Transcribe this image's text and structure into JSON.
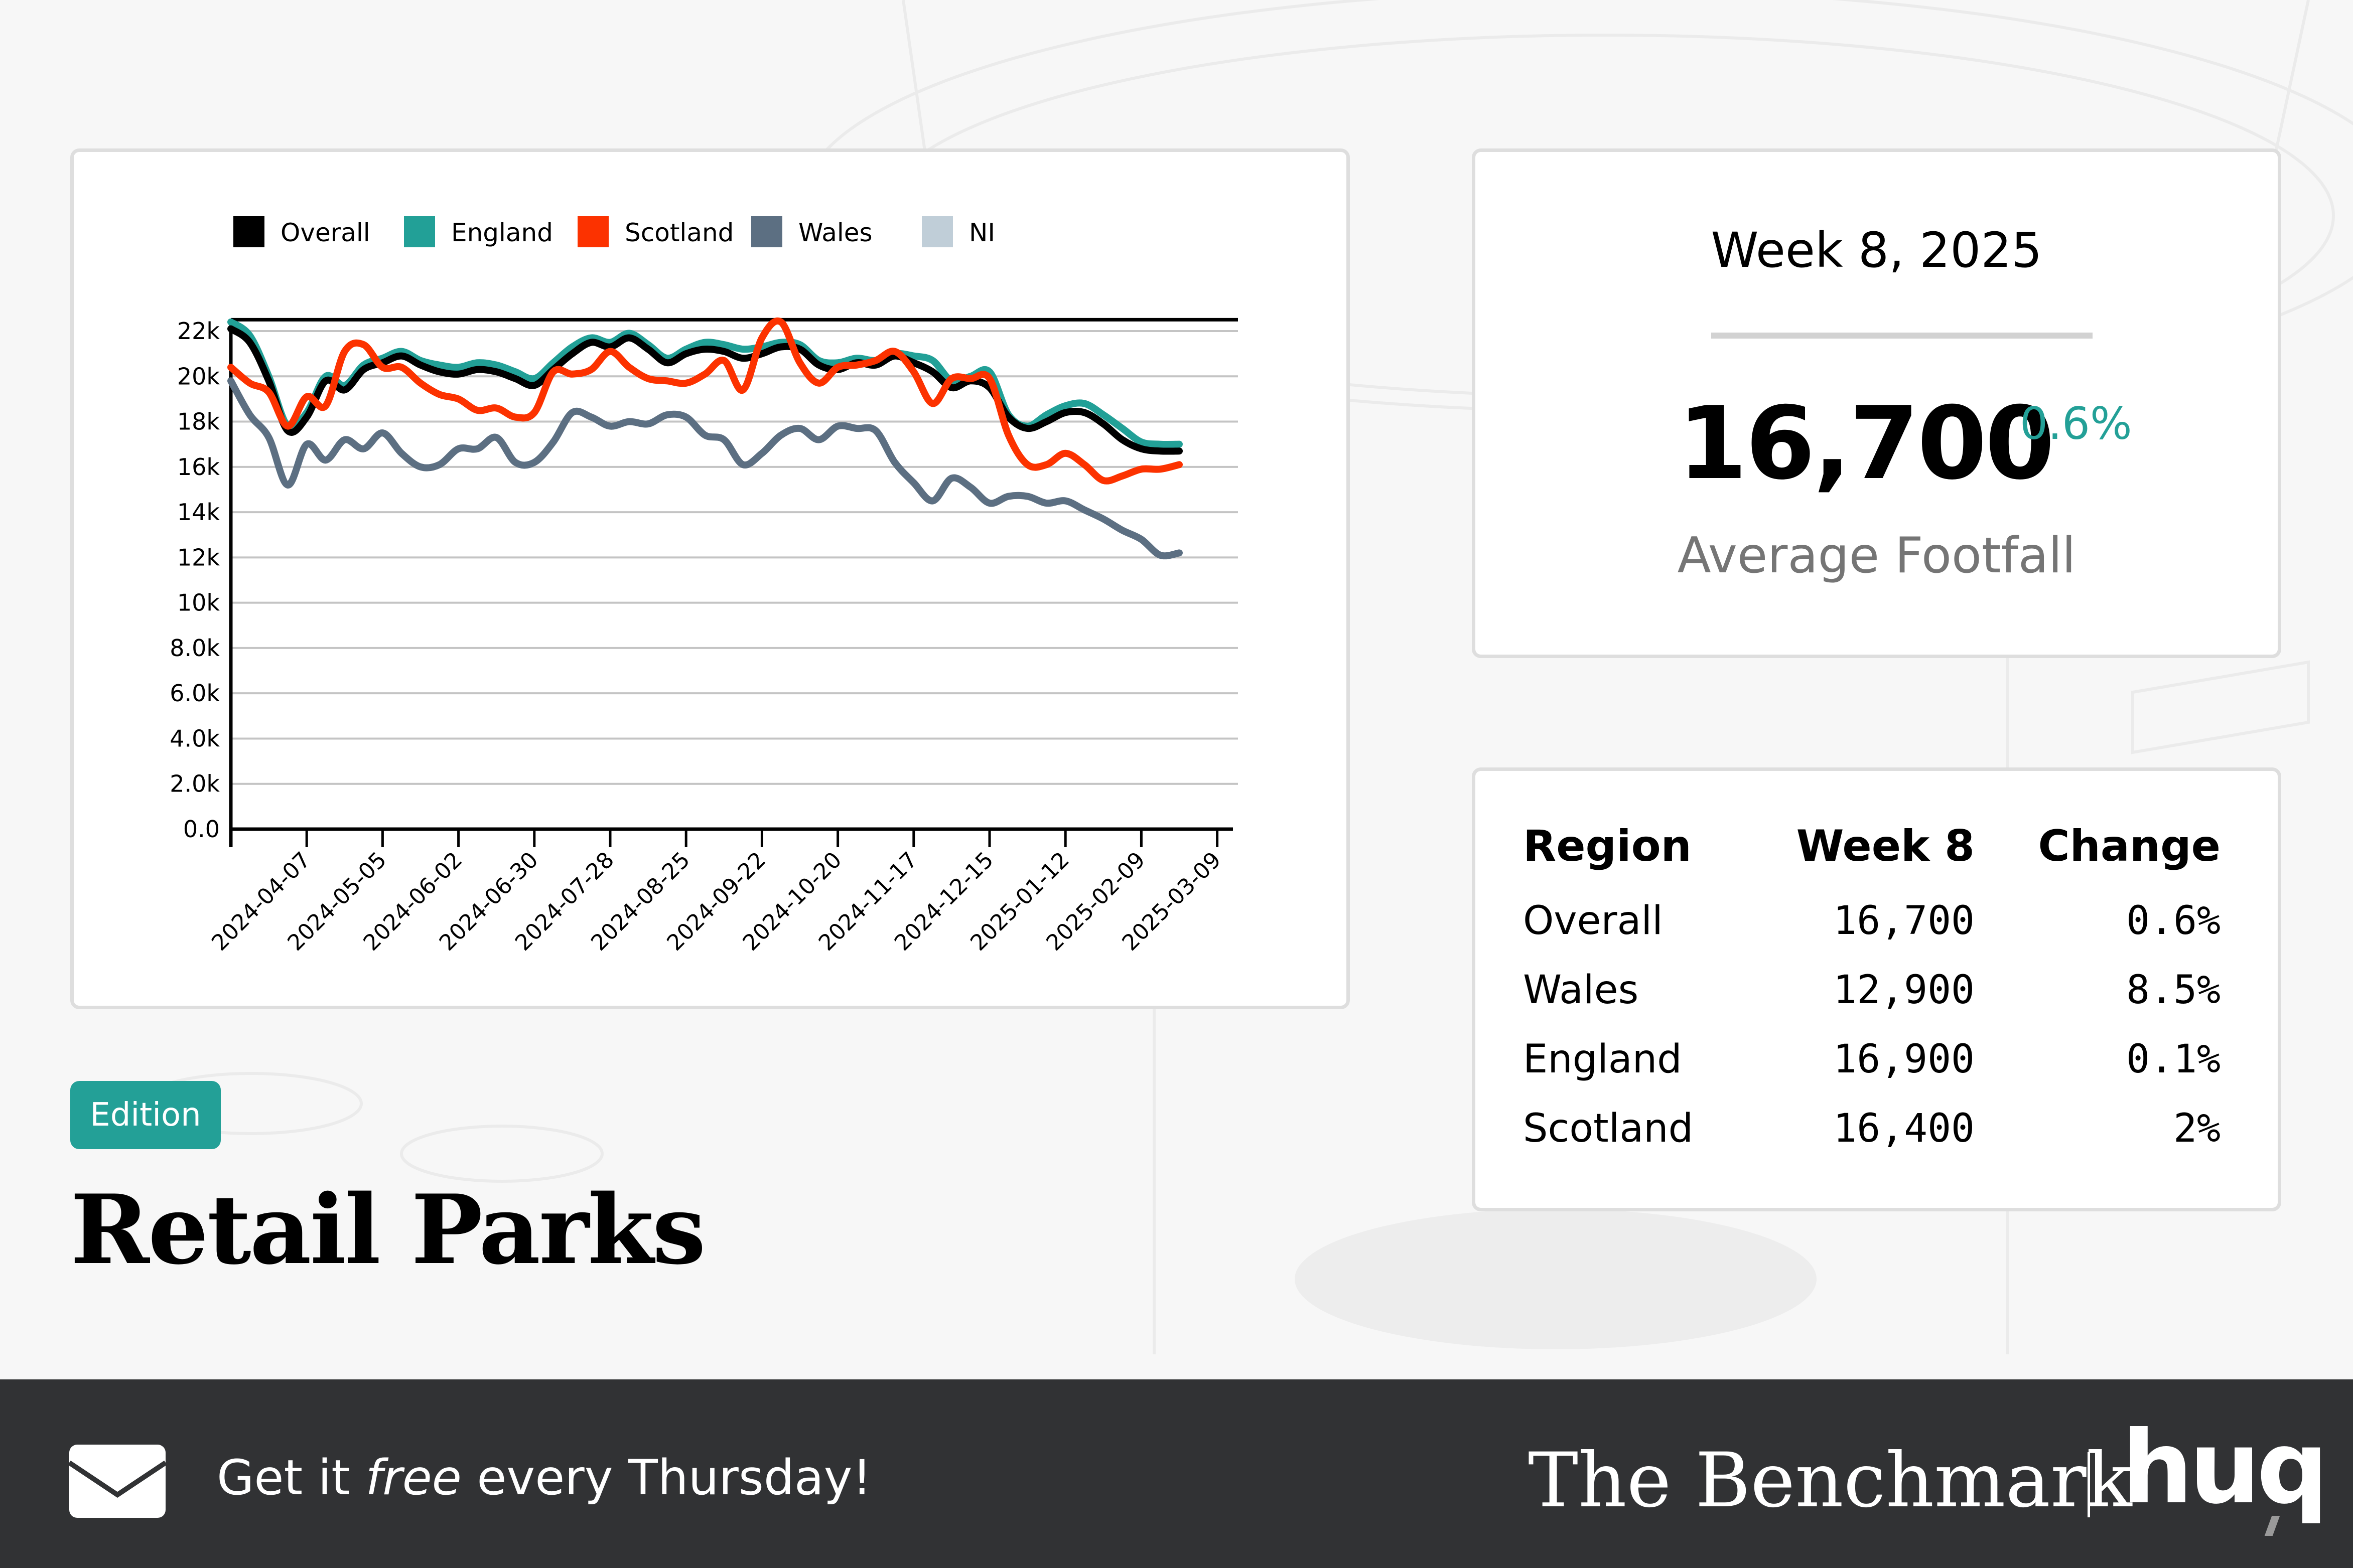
{
  "title": "Retail Parks",
  "badge": "Edition",
  "kpi": {
    "week_label": "Week 8, 2025",
    "value": "16,700",
    "change": "0.6%",
    "label": "Average Footfall"
  },
  "table": {
    "headers": [
      "Region",
      "Week 8",
      "Change"
    ],
    "rows": [
      {
        "region": "Overall",
        "week": "16,700",
        "change": "0.6%"
      },
      {
        "region": "Wales",
        "week": "12,900",
        "change": "8.5%"
      },
      {
        "region": "England",
        "week": "16,900",
        "change": "0.1%"
      },
      {
        "region": "Scotland",
        "week": "16,400",
        "change": "2%"
      }
    ]
  },
  "footer": {
    "cta_prefix": "Get it ",
    "cta_emphasis": "free",
    "cta_suffix": " every Thursday!",
    "brand": "The Benchmark",
    "logo": "huq",
    "icon": "envelope-icon"
  },
  "colors": {
    "accent": "#23a097",
    "Overall": "#000000",
    "England": "#22a097",
    "Scotland": "#fc3200",
    "Wales": "#5c6f82",
    "NI": "#c0ced8",
    "footer_bg": "#313234"
  },
  "chart_data": {
    "type": "line",
    "title": "",
    "xlabel": "",
    "ylabel": "",
    "ylim": [
      0,
      22500
    ],
    "grid": true,
    "legend": "top-left",
    "legend_entries": [
      "Overall",
      "England",
      "Scotland",
      "Wales",
      "NI"
    ],
    "y_ticks": [
      0,
      2000,
      4000,
      6000,
      8000,
      10000,
      12000,
      14000,
      16000,
      18000,
      20000,
      22000
    ],
    "y_tick_labels": [
      "0.0",
      "2.0k",
      "4.0k",
      "6.0k",
      "8.0k",
      "10k",
      "12k",
      "14k",
      "16k",
      "18k",
      "20k",
      "22k"
    ],
    "x_tick_labels": [
      "2024-04-07",
      "2024-05-05",
      "2024-06-02",
      "2024-06-30",
      "2024-07-28",
      "2024-08-25",
      "2024-09-22",
      "2024-10-20",
      "2024-11-17",
      "2024-12-15",
      "2025-01-12",
      "2025-02-09",
      "2025-03-09"
    ],
    "x_start": "2024-03-10",
    "x_end": "2025-03-16",
    "x_interval_days": 7,
    "series": [
      {
        "name": "Overall",
        "start": "2024-03-10",
        "values": [
          22100,
          21500,
          19800,
          17600,
          18200,
          19800,
          19400,
          20300,
          20600,
          20900,
          20500,
          20200,
          20100,
          20300,
          20200,
          19900,
          19600,
          20300,
          21000,
          21500,
          21300,
          21700,
          21200,
          20600,
          21000,
          21200,
          21100,
          20800,
          21000,
          21300,
          21200,
          20500,
          20300,
          20600,
          20500,
          20900,
          20600,
          20200,
          19500,
          19800,
          19500,
          18200,
          17700,
          18000,
          18400,
          18400,
          17900,
          17200,
          16800,
          16700,
          16700
        ]
      },
      {
        "name": "England",
        "start": "2024-03-10",
        "values": [
          22400,
          21800,
          20000,
          17800,
          18400,
          20000,
          19600,
          20500,
          20800,
          21100,
          20700,
          20500,
          20400,
          20600,
          20500,
          20200,
          19900,
          20600,
          21300,
          21700,
          21500,
          21900,
          21400,
          20800,
          21200,
          21500,
          21400,
          21200,
          21300,
          21500,
          21400,
          20700,
          20600,
          20800,
          20700,
          21000,
          20900,
          20700,
          19800,
          20000,
          20200,
          18300,
          17800,
          18300,
          18700,
          18800,
          18300,
          17700,
          17100,
          17000,
          17000
        ]
      },
      {
        "name": "Scotland",
        "start": "2024-03-10",
        "values": [
          20400,
          19700,
          19300,
          17800,
          19100,
          18700,
          21100,
          21400,
          20400,
          20400,
          19700,
          19200,
          19000,
          18500,
          18600,
          18200,
          18400,
          20200,
          20100,
          20300,
          21100,
          20400,
          19900,
          19800,
          19700,
          20100,
          20700,
          19400,
          21700,
          22400,
          20600,
          19700,
          20400,
          20500,
          20700,
          21100,
          20200,
          18800,
          19900,
          19900,
          19900,
          17400,
          16100,
          16100,
          16600,
          16100,
          15400,
          15600,
          15900,
          15900,
          16100
        ]
      },
      {
        "name": "Wales",
        "start": "2024-03-10",
        "values": [
          19800,
          18300,
          17300,
          15200,
          17000,
          16300,
          17200,
          16800,
          17500,
          16600,
          16000,
          16100,
          16800,
          16800,
          17300,
          16200,
          16200,
          17100,
          18400,
          18200,
          17800,
          18000,
          17900,
          18300,
          18200,
          17400,
          17200,
          16100,
          16600,
          17400,
          17700,
          17200,
          17800,
          17700,
          17600,
          16200,
          15300,
          14500,
          15500,
          15100,
          14400,
          14700,
          14700,
          14400,
          14500,
          14100,
          13700,
          13200,
          12800,
          12100,
          12200
        ]
      },
      {
        "name": "NI",
        "start": "2024-03-10",
        "values": []
      }
    ]
  }
}
